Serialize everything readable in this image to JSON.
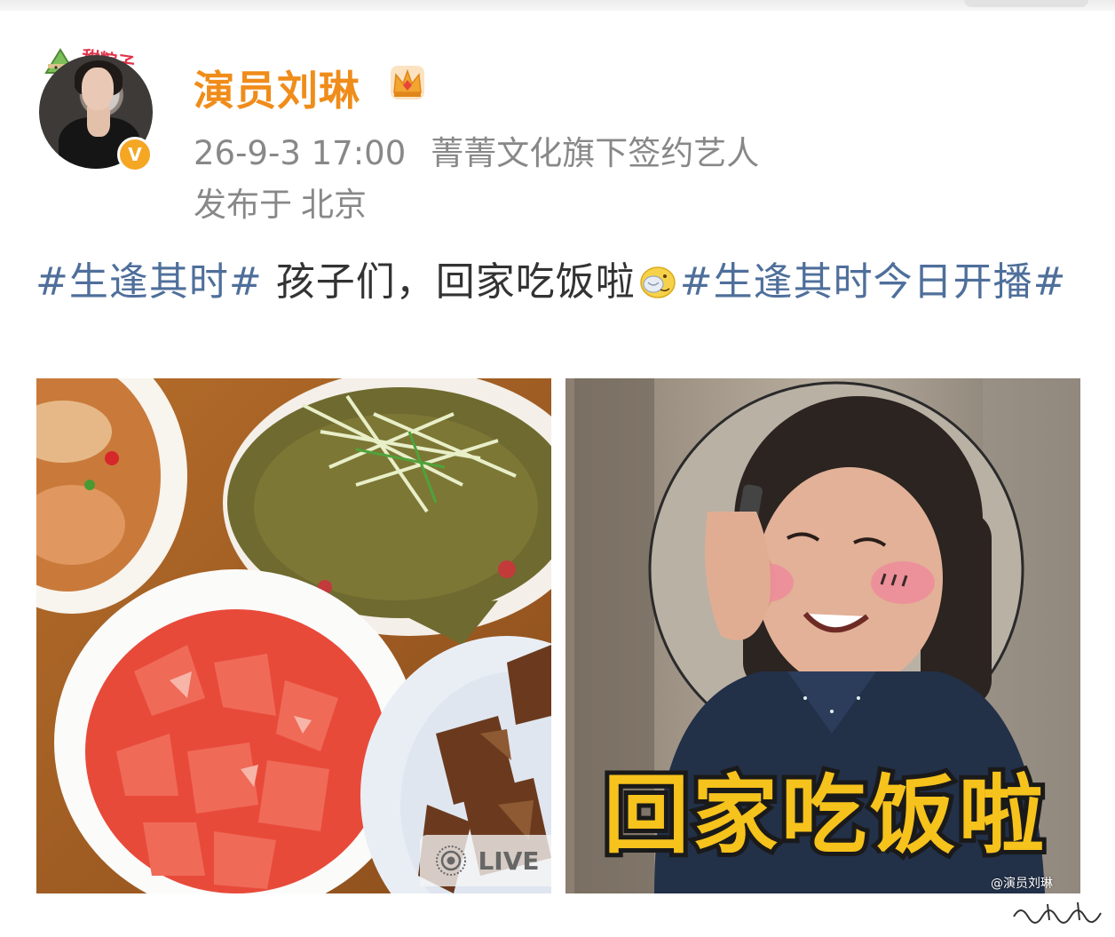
{
  "post": {
    "username": "演员刘琳",
    "timestamp": "26-9-3 17:00",
    "description": "菁菁文化旗下签约艺人",
    "location_prefix": "发布于",
    "location": "北京",
    "avatar_decoration_text": "甜粽子",
    "verified_mark": "V",
    "text": {
      "topic1": "#生逢其时#",
      "body": " 孩子们，回家吃饭啦",
      "topic2": "#生逢其时今日开播#"
    }
  },
  "images": {
    "left": {
      "description": "food-table-photo",
      "badge_label": "LIVE"
    },
    "right": {
      "description": "actress-on-phone-photo",
      "caption": "回家吃饭啦",
      "watermark": "@演员刘琳"
    }
  },
  "colors": {
    "username": "#f08c1a",
    "topic": "#4f6f9b",
    "meta": "#888888",
    "badge": "#f5a623",
    "caption_fill": "#f6c21c"
  },
  "icons": [
    "zongzi-icon",
    "crown-icon",
    "verified-badge-icon",
    "emoji-icon",
    "live-photo-icon"
  ]
}
